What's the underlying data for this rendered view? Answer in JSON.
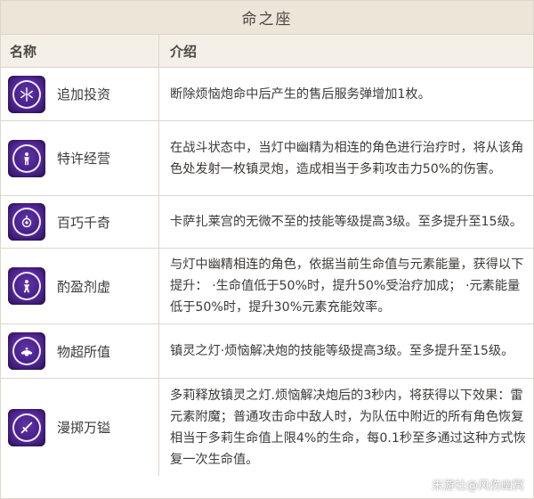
{
  "title": "命之座",
  "headers": {
    "name": "名称",
    "intro": "介绍"
  },
  "rows": [
    {
      "name": "追加投资",
      "icon": "sparkle-burst-icon",
      "desc": "断除烦恼炮命中后产生的售后服务弹增加1枚。"
    },
    {
      "name": "特许经营",
      "icon": "figure-icon",
      "desc": "在战斗状态中，当灯中幽精为相连的角色进行治疗时，将从该角色处发射一枚镇灵炮，造成相当于多莉攻击力50%的伤害。"
    },
    {
      "name": "百巧千奇",
      "icon": "lantern-icon",
      "desc": "卡萨扎莱宫的无微不至的技能等级提高3级。至多提升至15级。"
    },
    {
      "name": "酌盈剂虚",
      "icon": "figure-icon",
      "desc": "与灯中幽精相连的角色，依据当前生命值与元素能量，获得以下提升：  ·生命值低于50%时，提升50%受治疗加成；  ·元素能量低于50%时，提升30%元素充能效率。"
    },
    {
      "name": "物超所值",
      "icon": "lamp-icon",
      "desc": "镇灵之灯·烦恼解决炮的技能等级提高3级。至多提升至15级。"
    },
    {
      "name": "漫掷万镒",
      "icon": "blade-icon",
      "desc": "多莉释放镇灵之灯.烦恼解决炮后的3秒内，将获得以下效果：雷元素附魔；普通攻击命中敌人时，为队伍中附近的所有角色恢复相当于多莉生命值上限4%的生命，每0.1秒至多通过这种方式恢复一次生命值。"
    }
  ],
  "watermark": "米游社@风伤幽冥"
}
